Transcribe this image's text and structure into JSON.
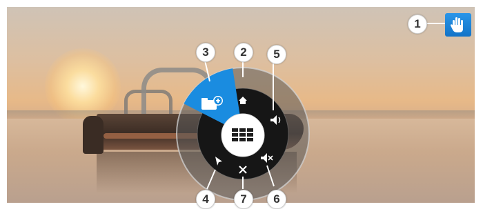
{
  "callouts": [
    {
      "id": "c1",
      "label": "1"
    },
    {
      "id": "c2",
      "label": "2"
    },
    {
      "id": "c3",
      "label": "3"
    },
    {
      "id": "c4",
      "label": "4"
    },
    {
      "id": "c5",
      "label": "5"
    },
    {
      "id": "c6",
      "label": "6"
    },
    {
      "id": "c7",
      "label": "7"
    }
  ],
  "wheel_menu": {
    "center": {
      "icon": "keypad-grid-icon"
    },
    "items": [
      {
        "icon": "home-icon"
      },
      {
        "icon": "add-folder-icon",
        "highlighted": true
      },
      {
        "icon": "volume-up-icon"
      },
      {
        "icon": "mute-icon"
      },
      {
        "icon": "close-icon"
      },
      {
        "icon": "cursor-pointer-icon"
      }
    ]
  },
  "pointer_mode_button": {
    "icon": "hand-icon"
  },
  "colors": {
    "accent": "#1a8ce0",
    "wheel_dark": "#1c1c1c",
    "wheel_outer": "#5a5a5a",
    "callout_bg": "#ffffff"
  }
}
